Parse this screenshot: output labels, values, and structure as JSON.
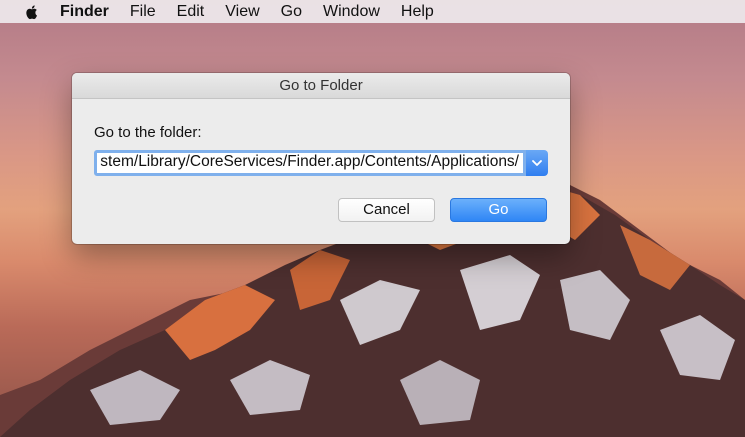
{
  "menubar": {
    "apple_icon": "apple-logo-icon",
    "app_name": "Finder",
    "items": [
      "File",
      "Edit",
      "View",
      "Go",
      "Window",
      "Help"
    ]
  },
  "dialog": {
    "title": "Go to Folder",
    "prompt": "Go to the folder:",
    "path_value": "stem/Library/CoreServices/Finder.app/Contents/Applications/",
    "dropdown_icon": "chevron-down-icon",
    "cancel_label": "Cancel",
    "go_label": "Go"
  },
  "colors": {
    "accent": "#2f86f5",
    "focus_ring": "#7fb0ec",
    "dialog_bg": "#ececec"
  }
}
